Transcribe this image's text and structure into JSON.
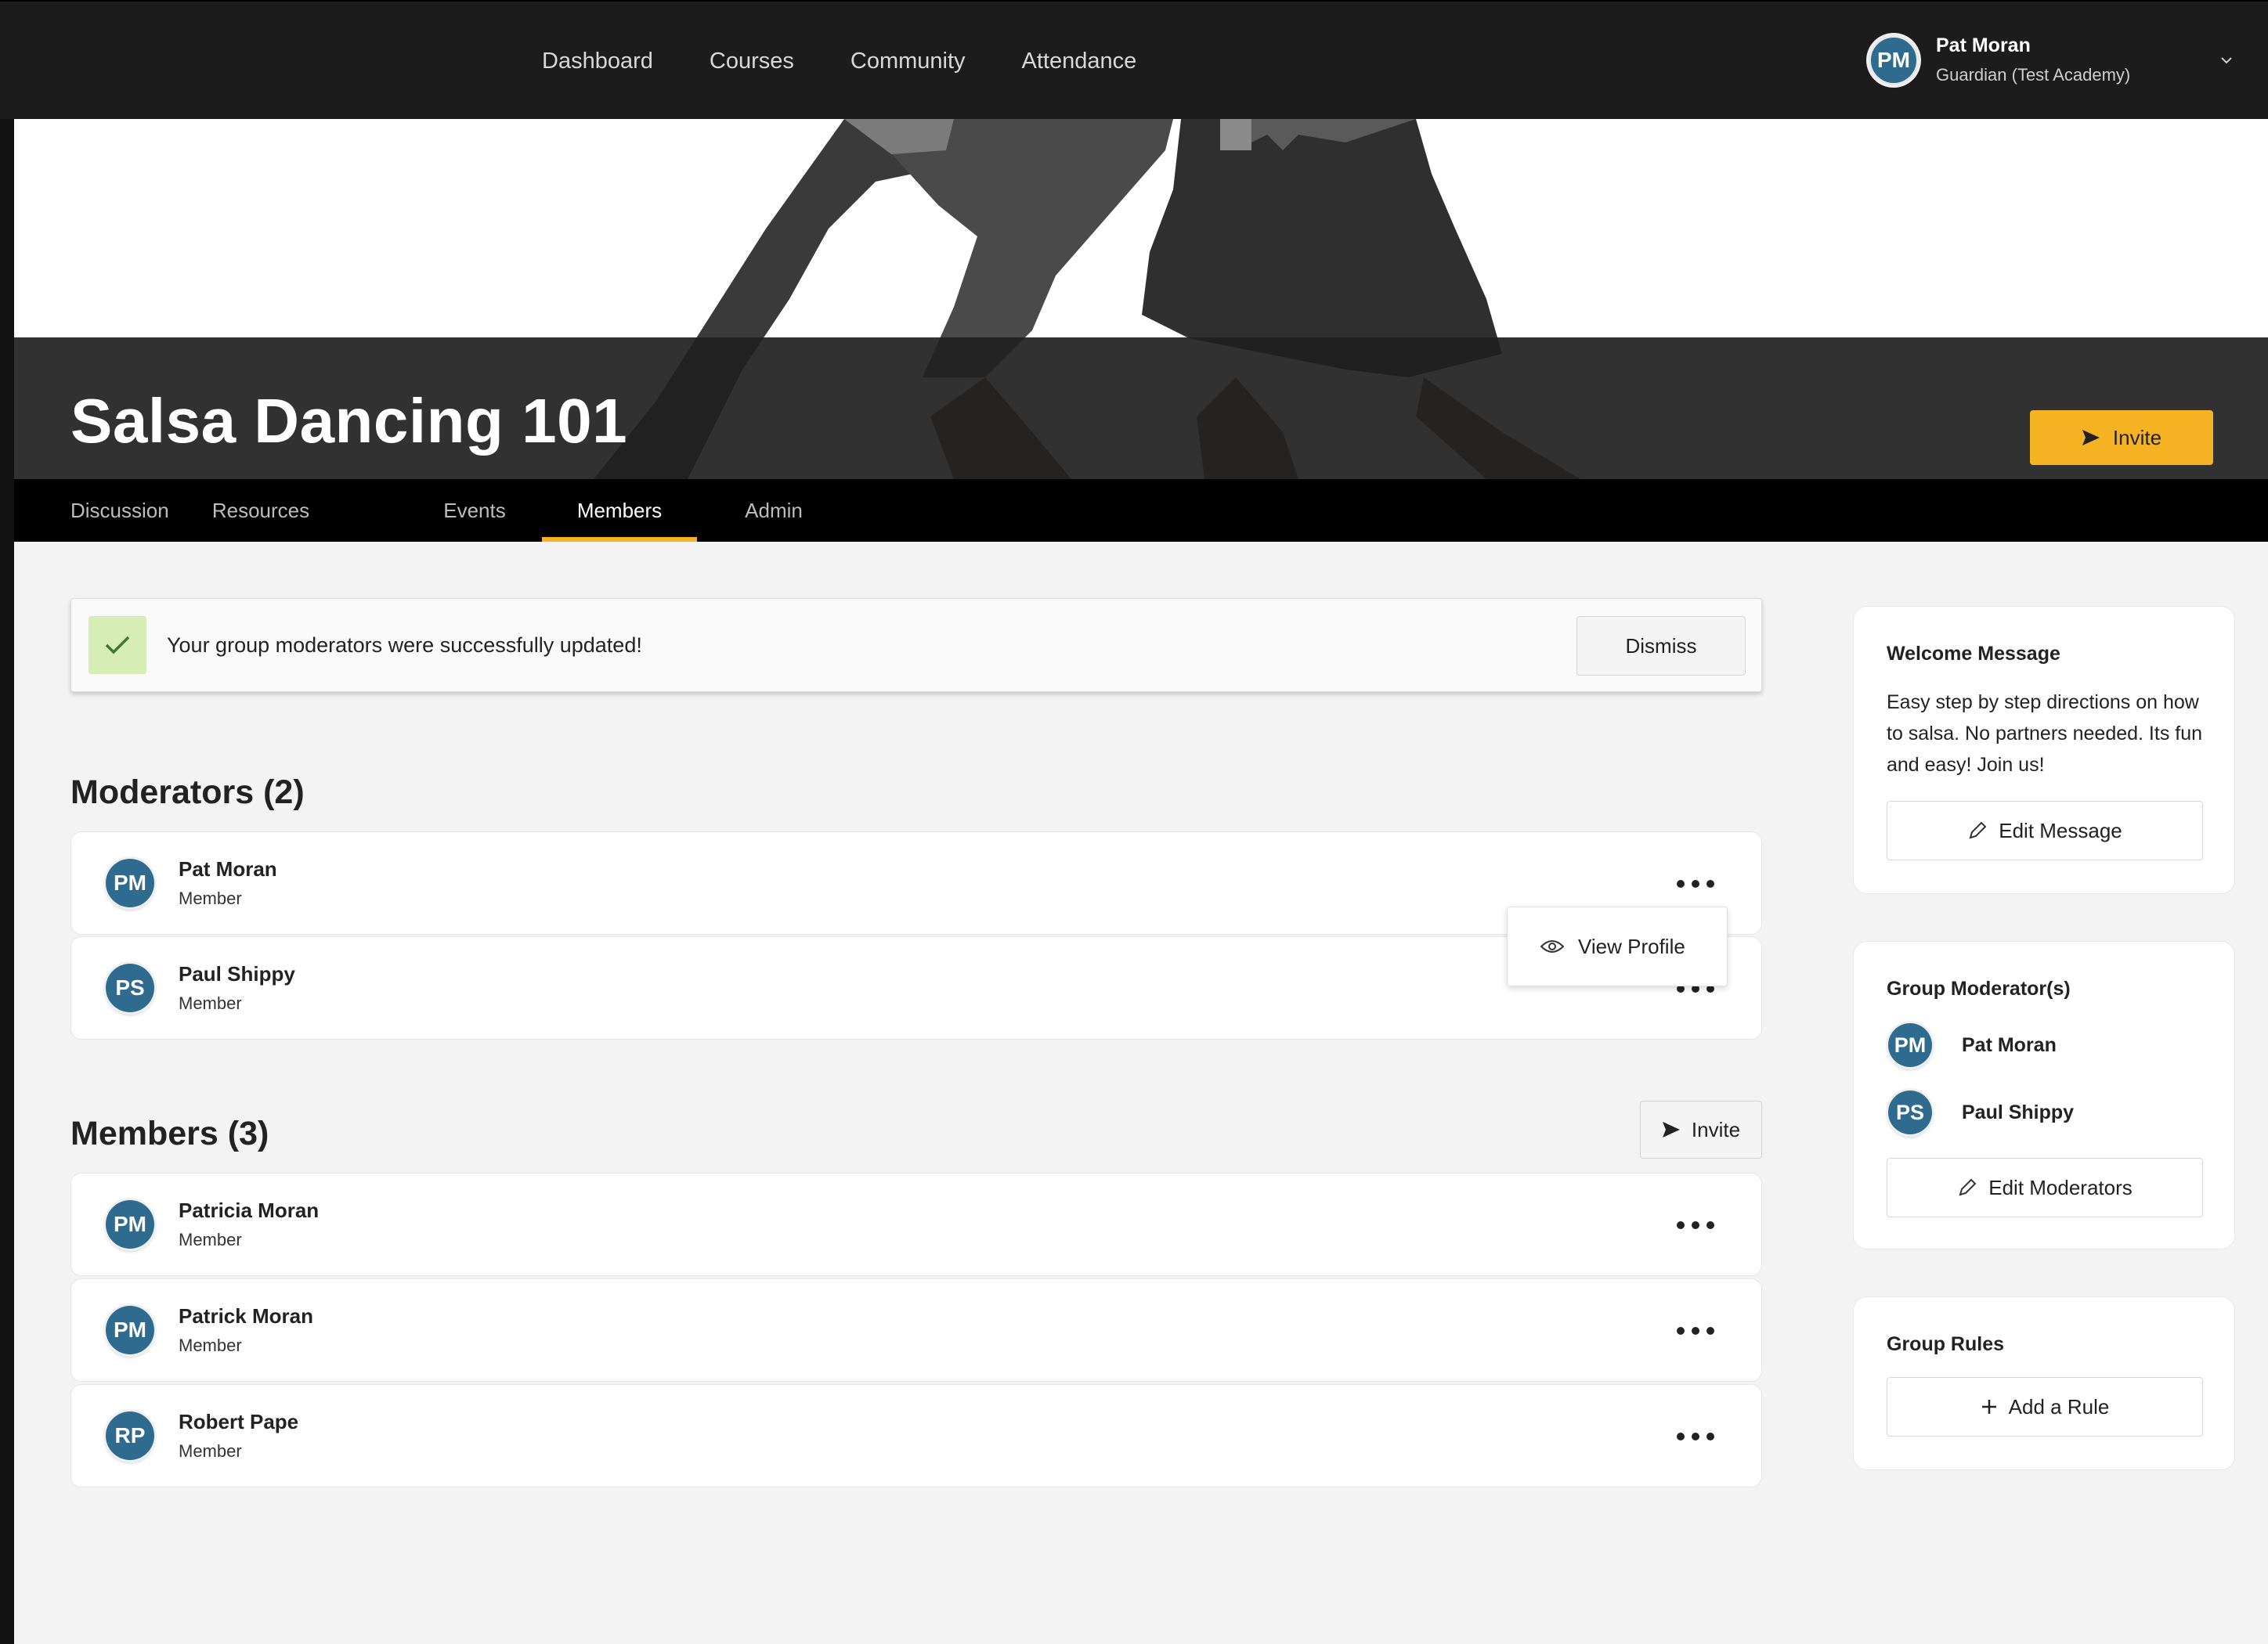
{
  "nav": {
    "links": [
      "Dashboard",
      "Courses",
      "Community",
      "Attendance"
    ],
    "user": {
      "initials": "PM",
      "name": "Pat Moran",
      "role": "Guardian (Test Academy)"
    }
  },
  "group": {
    "title": "Salsa Dancing 101",
    "invite_label": "Invite"
  },
  "tabs": [
    "Discussion",
    "Resources",
    "Events",
    "Members",
    "Admin"
  ],
  "active_tab": "Members",
  "alert": {
    "message": "Your group moderators were successfully updated!",
    "dismiss_label": "Dismiss"
  },
  "moderators": {
    "title": "Moderators (2)",
    "items": [
      {
        "initials": "PM",
        "name": "Pat Moran",
        "role": "Member"
      },
      {
        "initials": "PS",
        "name": "Paul Shippy",
        "role": "Member"
      }
    ],
    "popup_label": "View Profile"
  },
  "members": {
    "title": "Members (3)",
    "invite_label": "Invite",
    "items": [
      {
        "initials": "PM",
        "name": "Patricia Moran",
        "role": "Member"
      },
      {
        "initials": "PM",
        "name": "Patrick Moran",
        "role": "Member"
      },
      {
        "initials": "RP",
        "name": "Robert Pape",
        "role": "Member"
      }
    ]
  },
  "sidebar": {
    "welcome": {
      "title": "Welcome Message",
      "text": "Easy step by step directions on how to salsa. No partners needed. Its fun and easy! Join us!",
      "button": "Edit Message"
    },
    "moderators": {
      "title": "Group Moderator(s)",
      "items": [
        {
          "initials": "PM",
          "name": "Pat Moran"
        },
        {
          "initials": "PS",
          "name": "Paul Shippy"
        }
      ],
      "button": "Edit Moderators"
    },
    "rules": {
      "title": "Group Rules",
      "button": "Add a Rule"
    }
  },
  "colors": {
    "accent": "#f5b324",
    "avatar": "#2f6b8f",
    "topbar": "#1c1c1c",
    "success_bg": "#d6eeb6"
  }
}
